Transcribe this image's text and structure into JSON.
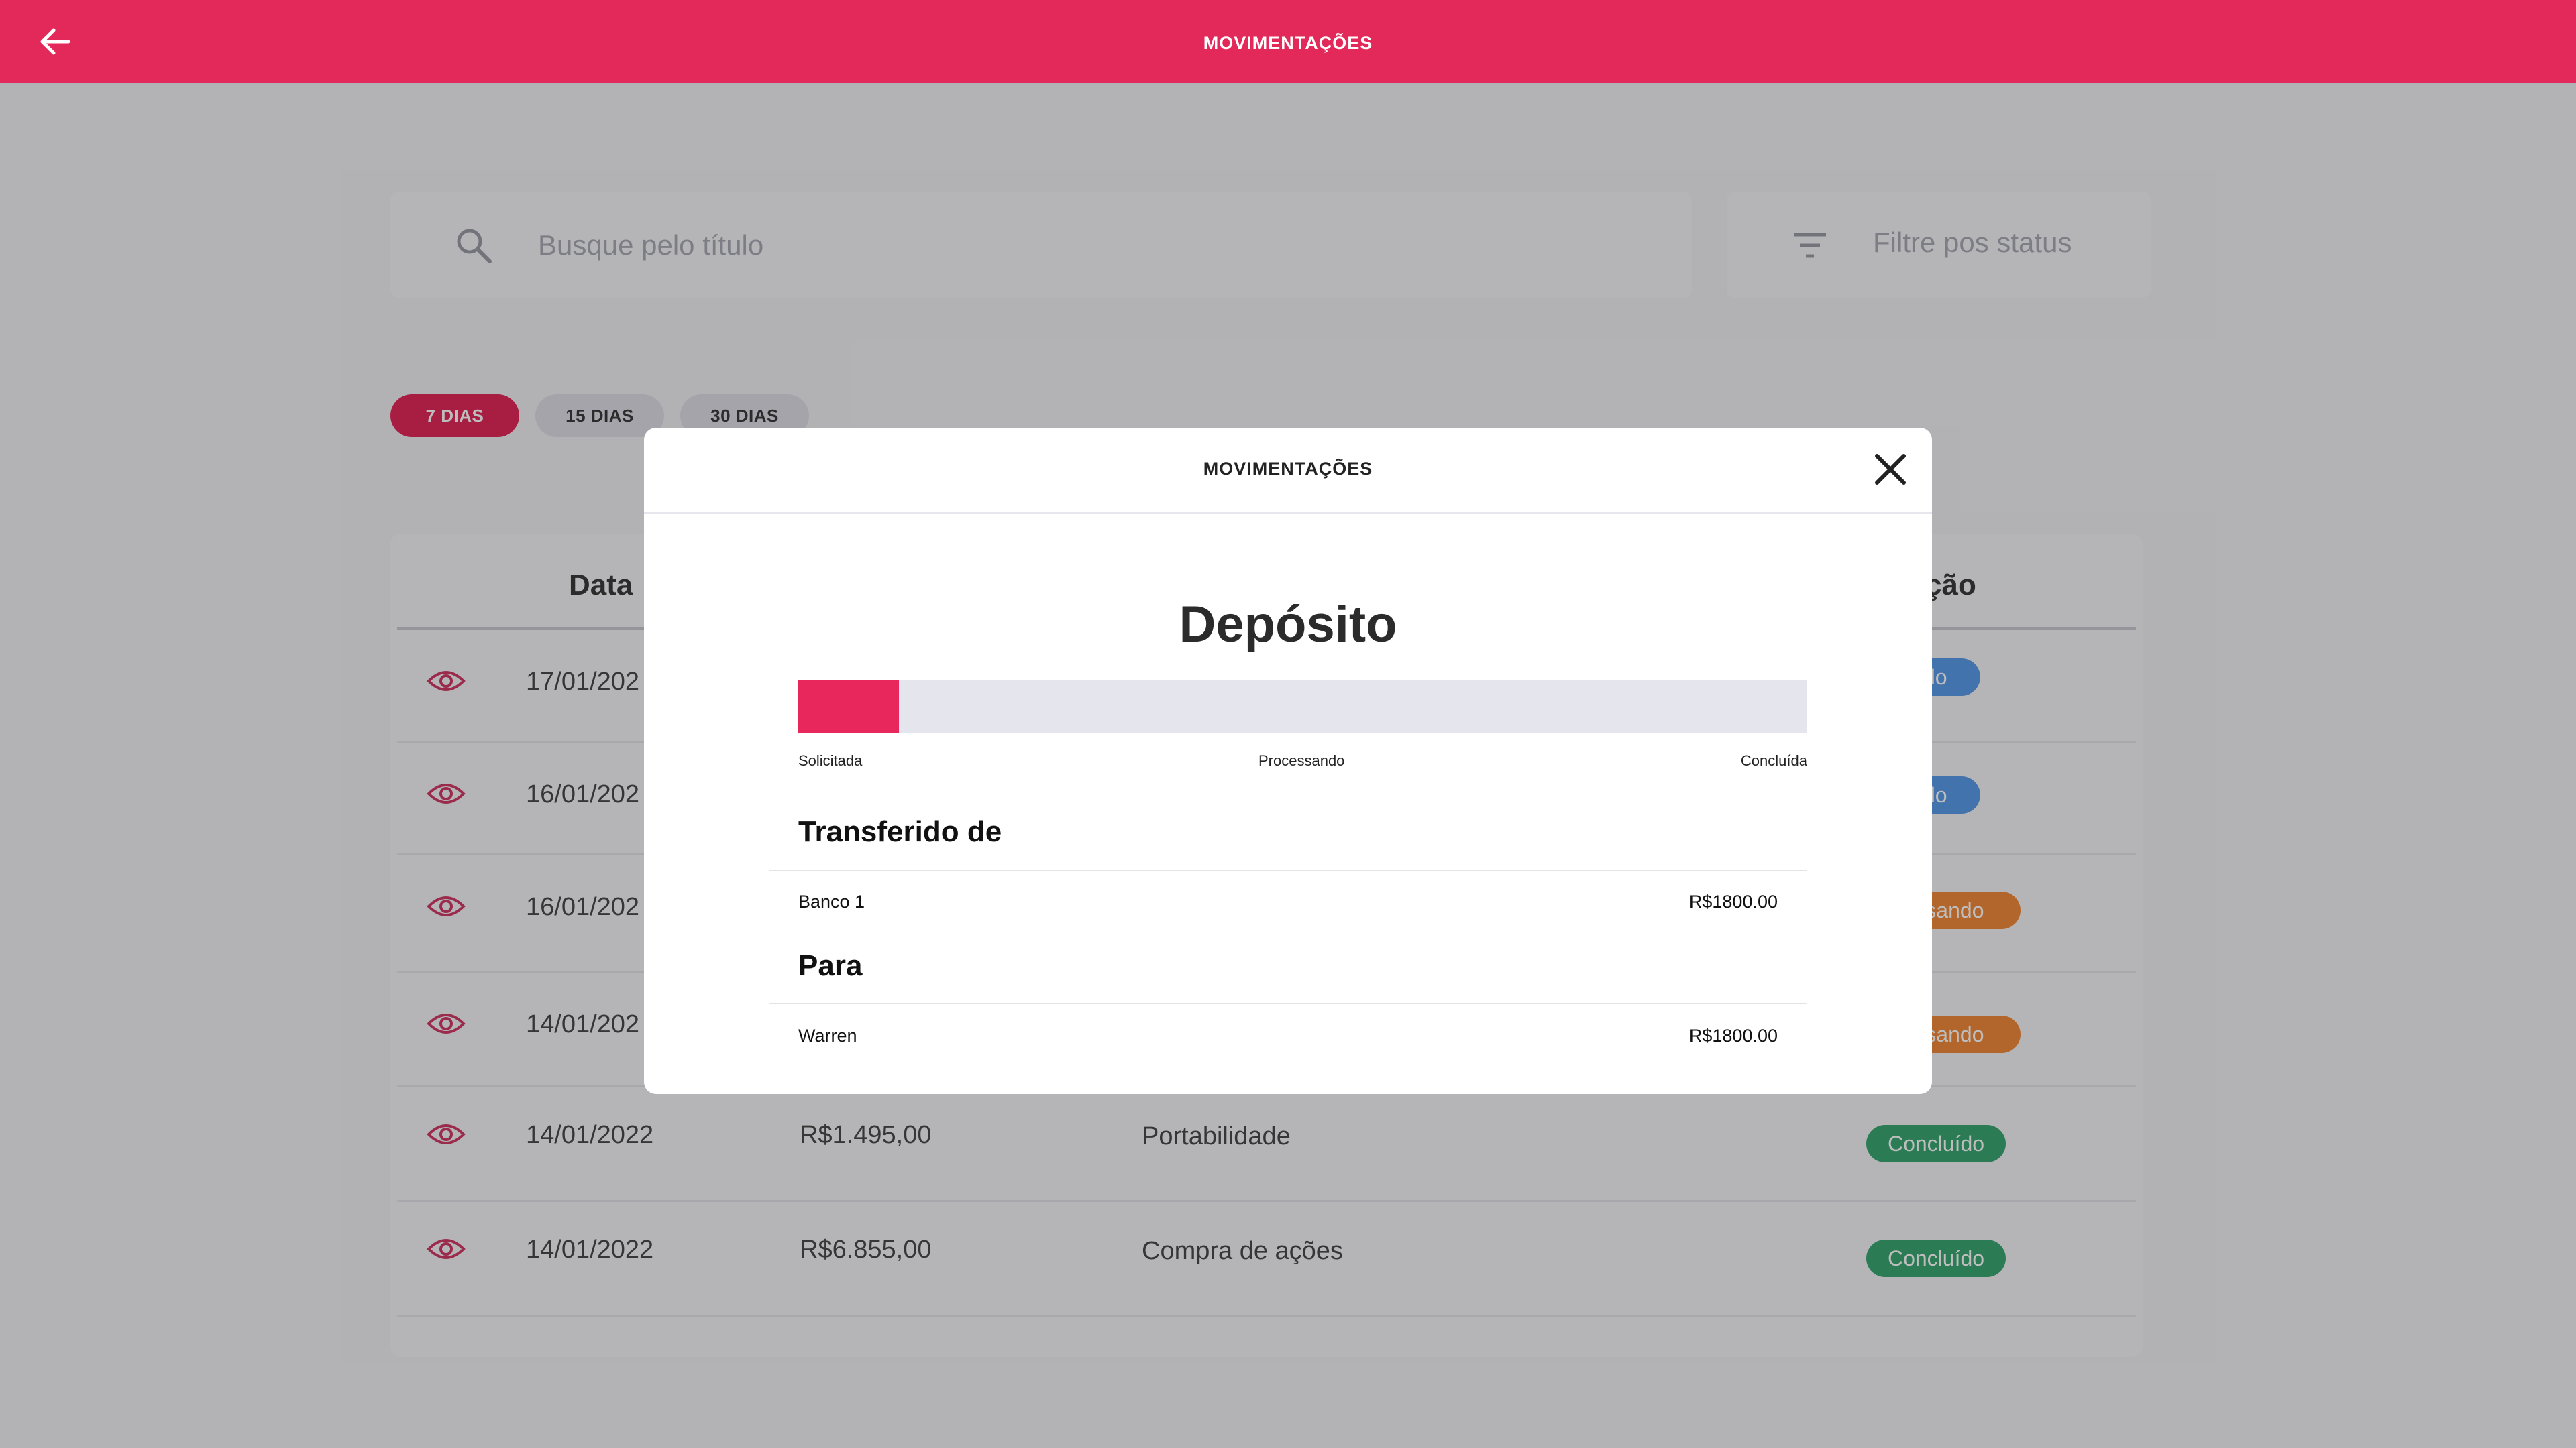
{
  "header": {
    "title": "MOVIMENTAÇÕES",
    "back_icon": "arrow-left-icon"
  },
  "search": {
    "placeholder": "Busque pelo título",
    "icon": "search-icon"
  },
  "filter": {
    "label": "Filtre pos status",
    "icon": "filter-icon"
  },
  "periods": [
    {
      "label": "7 DIAS",
      "active": true
    },
    {
      "label": "15 DIAS",
      "active": false
    },
    {
      "label": "30 DIAS",
      "active": false
    }
  ],
  "table": {
    "headers": {
      "date": "Data",
      "status": "ção"
    },
    "rows": [
      {
        "date": "17/01/202",
        "value": "",
        "description": "",
        "status": "dado",
        "status_color": "#5b9bea"
      },
      {
        "date": "16/01/202",
        "value": "",
        "description": "",
        "status": "dado",
        "status_color": "#5b9bea"
      },
      {
        "date": "16/01/202",
        "value": "",
        "description": "",
        "status": "essando",
        "status_color": "#f08a3c"
      },
      {
        "date": "14/01/202",
        "value": "",
        "description": "",
        "status": "essando",
        "status_color": "#f08a3c"
      },
      {
        "date": "14/01/2022",
        "value": "R$1.495,00",
        "description": "Portabilidade",
        "status": "Concluído",
        "status_color": "#3aa872"
      },
      {
        "date": "14/01/2022",
        "value": "R$6.855,00",
        "description": "Compra de ações",
        "status": "Concluído",
        "status_color": "#3aa872"
      }
    ]
  },
  "modal": {
    "title": "MOVIMENTAÇÕES",
    "close_icon": "close-icon",
    "heading": "Depósito",
    "progress": {
      "fraction": 0.1,
      "color": "#e8275d",
      "steps": [
        "Solicitada",
        "Processando",
        "Concluída"
      ]
    },
    "from": {
      "title": "Transferido de",
      "name": "Banco 1",
      "amount": "R$1800.00"
    },
    "to": {
      "title": "Para",
      "name": "Warren",
      "amount": "R$1800.00"
    }
  },
  "colors": {
    "brand": "#e3285a",
    "overlay": "rgba(0,0,0,0.26)"
  }
}
